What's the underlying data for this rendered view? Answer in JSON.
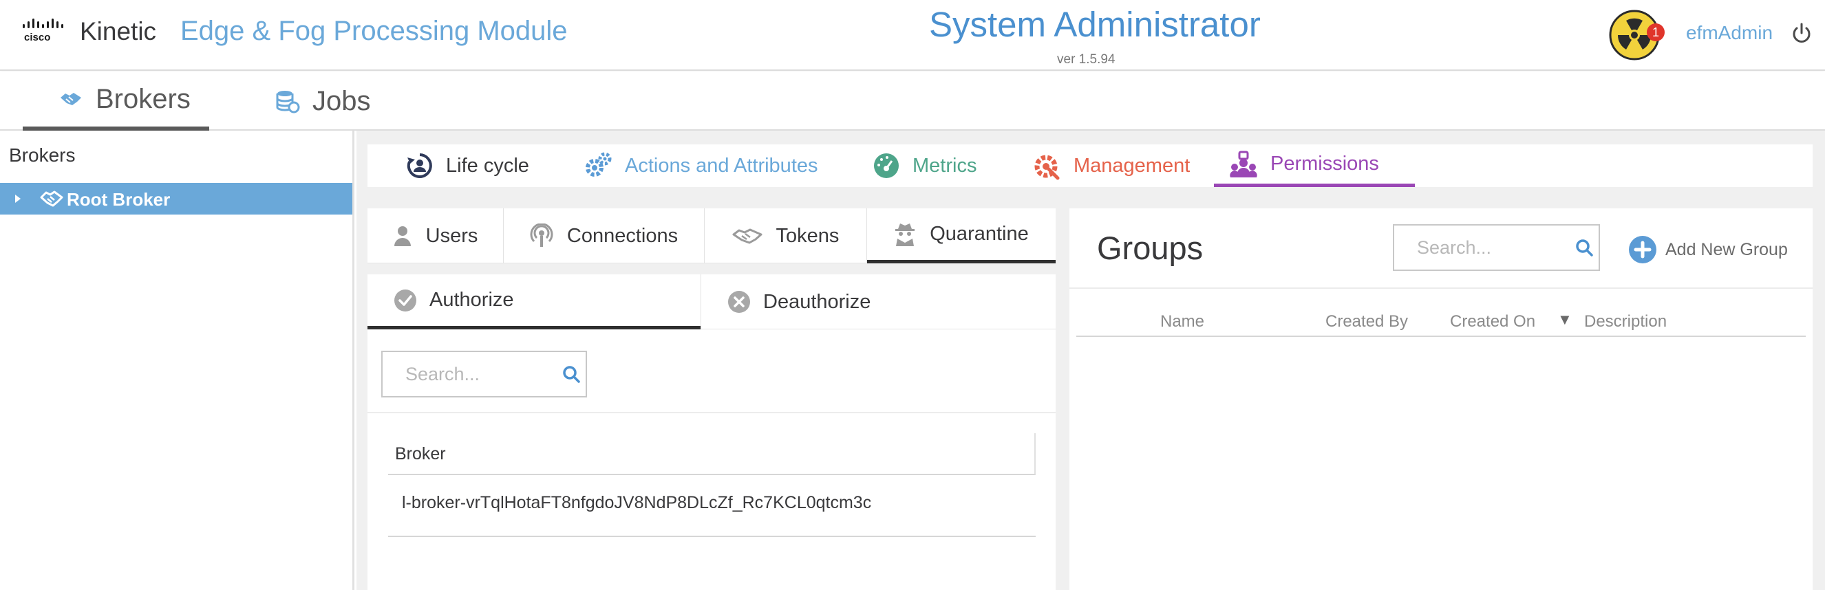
{
  "header": {
    "brand": "Kinetic",
    "module": "Edge & Fog Processing Module",
    "title": "System Administrator",
    "version": "ver 1.5.94",
    "alert_count": "1",
    "username": "efmAdmin",
    "logo_icon": "cisco-logo-icon",
    "alert_icon": "radiation-hazard-icon",
    "power_icon": "power-icon"
  },
  "nav": {
    "tabs": [
      {
        "label": "Brokers",
        "icon": "handshake-icon",
        "active": true
      },
      {
        "label": "Jobs",
        "icon": "database-sync-icon",
        "active": false
      }
    ]
  },
  "sidebar": {
    "title": "Brokers",
    "tree": [
      {
        "label": "Root Broker",
        "icon": "handshake-icon",
        "selected": true,
        "expanded": false
      }
    ]
  },
  "perm_tabs": [
    {
      "label": "Life cycle",
      "icon": "lifecycle-icon",
      "color": "#39393b"
    },
    {
      "label": "Actions and Attributes",
      "icon": "gears-icon",
      "color": "#6aa8d9"
    },
    {
      "label": "Metrics",
      "icon": "gauge-icon",
      "color": "#4ea58a"
    },
    {
      "label": "Management",
      "icon": "wrench-gear-icon",
      "color": "#e5624a"
    },
    {
      "label": "Permissions",
      "icon": "users-lock-icon",
      "color": "#9a47b5",
      "active": true
    }
  ],
  "subtabs": [
    {
      "label": "Users",
      "icon": "user-icon"
    },
    {
      "label": "Connections",
      "icon": "broadcast-icon"
    },
    {
      "label": "Tokens",
      "icon": "handshake-icon"
    },
    {
      "label": "Quarantine",
      "icon": "spy-icon",
      "active": true
    }
  ],
  "auth_tabs": [
    {
      "label": "Authorize",
      "icon": "check-circle-icon",
      "active": true
    },
    {
      "label": "Deauthorize",
      "icon": "x-circle-icon"
    }
  ],
  "left_search": {
    "placeholder": "Search..."
  },
  "broker_table": {
    "header": "Broker",
    "rows": [
      "l-broker-vrTqlHotaFT8nfgdoJV8NdP8DLcZf_Rc7KCL0qtcm3c"
    ]
  },
  "groups": {
    "title": "Groups",
    "search_placeholder": "Search...",
    "add_label": "Add New Group",
    "columns": [
      "Name",
      "Created By",
      "Created On",
      "Description"
    ],
    "sort_indicator": "▼",
    "rows": []
  },
  "colors": {
    "accent_blue": "#6aa8d9",
    "permissions_purple": "#9a47b5",
    "management_red": "#e5624a",
    "metrics_green": "#4ea58a",
    "alert_red": "#e0352b",
    "hazard_yellow": "#f2d23c"
  }
}
